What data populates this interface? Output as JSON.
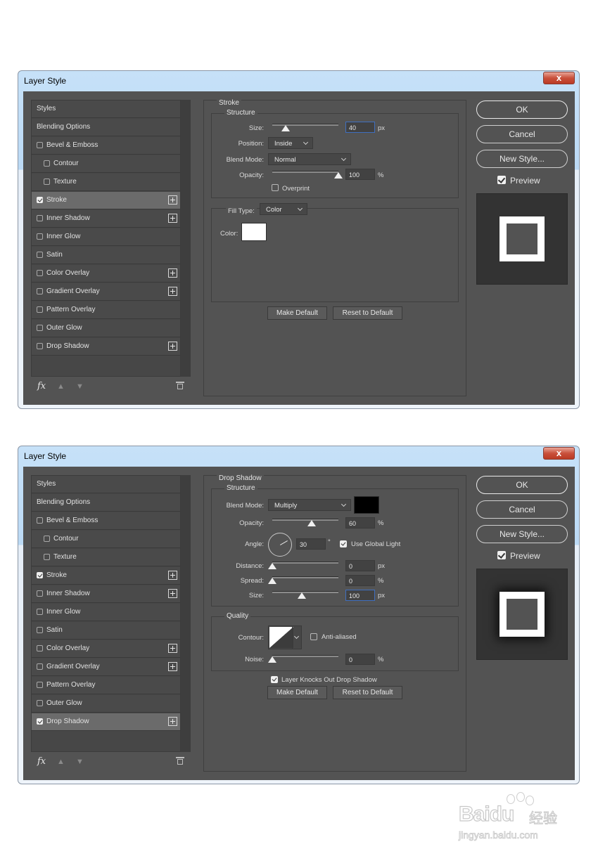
{
  "dialog1": {
    "title": "Layer Style",
    "close_label": "x",
    "list": [
      {
        "label": "Styles",
        "checkbox": false,
        "checked": false,
        "plus": false,
        "indent": false,
        "selected": false
      },
      {
        "label": "Blending Options",
        "checkbox": false,
        "checked": false,
        "plus": false,
        "indent": false,
        "selected": false
      },
      {
        "label": "Bevel & Emboss",
        "checkbox": true,
        "checked": false,
        "plus": false,
        "indent": false,
        "selected": false
      },
      {
        "label": "Contour",
        "checkbox": true,
        "checked": false,
        "plus": false,
        "indent": true,
        "selected": false
      },
      {
        "label": "Texture",
        "checkbox": true,
        "checked": false,
        "plus": false,
        "indent": true,
        "selected": false
      },
      {
        "label": "Stroke",
        "checkbox": true,
        "checked": true,
        "plus": true,
        "indent": false,
        "selected": true
      },
      {
        "label": "Inner Shadow",
        "checkbox": true,
        "checked": false,
        "plus": true,
        "indent": false,
        "selected": false
      },
      {
        "label": "Inner Glow",
        "checkbox": true,
        "checked": false,
        "plus": false,
        "indent": false,
        "selected": false
      },
      {
        "label": "Satin",
        "checkbox": true,
        "checked": false,
        "plus": false,
        "indent": false,
        "selected": false
      },
      {
        "label": "Color Overlay",
        "checkbox": true,
        "checked": false,
        "plus": true,
        "indent": false,
        "selected": false
      },
      {
        "label": "Gradient Overlay",
        "checkbox": true,
        "checked": false,
        "plus": true,
        "indent": false,
        "selected": false
      },
      {
        "label": "Pattern Overlay",
        "checkbox": true,
        "checked": false,
        "plus": false,
        "indent": false,
        "selected": false
      },
      {
        "label": "Outer Glow",
        "checkbox": true,
        "checked": false,
        "plus": false,
        "indent": false,
        "selected": false
      },
      {
        "label": "Drop Shadow",
        "checkbox": true,
        "checked": false,
        "plus": true,
        "indent": false,
        "selected": false
      }
    ],
    "fx_label": "fx",
    "panel": {
      "title": "Stroke",
      "structure_title": "Structure",
      "size_label": "Size:",
      "size_value": "40",
      "size_unit": "px",
      "size_fraction": 0.2,
      "position_label": "Position:",
      "position_value": "Inside",
      "blend_label": "Blend Mode:",
      "blend_value": "Normal",
      "opacity_label": "Opacity:",
      "opacity_value": "100",
      "opacity_unit": "%",
      "opacity_fraction": 1.0,
      "overprint_label": "Overprint",
      "filltype_label": "Fill Type:",
      "filltype_value": "Color",
      "color_label": "Color:",
      "stroke_color": "#ffffff",
      "make_default": "Make Default",
      "reset_default": "Reset to Default"
    },
    "buttons": {
      "ok": "OK",
      "cancel": "Cancel",
      "new_style": "New Style...",
      "preview": "Preview"
    }
  },
  "dialog2": {
    "title": "Layer Style",
    "close_label": "x",
    "list": [
      {
        "label": "Styles",
        "checkbox": false,
        "checked": false,
        "plus": false,
        "indent": false,
        "selected": false
      },
      {
        "label": "Blending Options",
        "checkbox": false,
        "checked": false,
        "plus": false,
        "indent": false,
        "selected": false
      },
      {
        "label": "Bevel & Emboss",
        "checkbox": true,
        "checked": false,
        "plus": false,
        "indent": false,
        "selected": false
      },
      {
        "label": "Contour",
        "checkbox": true,
        "checked": false,
        "plus": false,
        "indent": true,
        "selected": false
      },
      {
        "label": "Texture",
        "checkbox": true,
        "checked": false,
        "plus": false,
        "indent": true,
        "selected": false
      },
      {
        "label": "Stroke",
        "checkbox": true,
        "checked": true,
        "plus": true,
        "indent": false,
        "selected": false
      },
      {
        "label": "Inner Shadow",
        "checkbox": true,
        "checked": false,
        "plus": true,
        "indent": false,
        "selected": false
      },
      {
        "label": "Inner Glow",
        "checkbox": true,
        "checked": false,
        "plus": false,
        "indent": false,
        "selected": false
      },
      {
        "label": "Satin",
        "checkbox": true,
        "checked": false,
        "plus": false,
        "indent": false,
        "selected": false
      },
      {
        "label": "Color Overlay",
        "checkbox": true,
        "checked": false,
        "plus": true,
        "indent": false,
        "selected": false
      },
      {
        "label": "Gradient Overlay",
        "checkbox": true,
        "checked": false,
        "plus": true,
        "indent": false,
        "selected": false
      },
      {
        "label": "Pattern Overlay",
        "checkbox": true,
        "checked": false,
        "plus": false,
        "indent": false,
        "selected": false
      },
      {
        "label": "Outer Glow",
        "checkbox": true,
        "checked": false,
        "plus": false,
        "indent": false,
        "selected": false
      },
      {
        "label": "Drop Shadow",
        "checkbox": true,
        "checked": true,
        "plus": true,
        "indent": false,
        "selected": true
      }
    ],
    "fx_label": "fx",
    "panel": {
      "title": "Drop Shadow",
      "structure_title": "Structure",
      "blend_label": "Blend Mode:",
      "blend_value": "Multiply",
      "shadow_color": "#000000",
      "opacity_label": "Opacity:",
      "opacity_value": "60",
      "opacity_unit": "%",
      "opacity_fraction": 0.6,
      "angle_label": "Angle:",
      "angle_value": "30",
      "angle_unit": "°",
      "global_light_label": "Use Global Light",
      "distance_label": "Distance:",
      "distance_value": "0",
      "distance_unit": "px",
      "distance_fraction": 0.0,
      "spread_label": "Spread:",
      "spread_value": "0",
      "spread_unit": "%",
      "spread_fraction": 0.0,
      "size_label": "Size:",
      "size_value": "100",
      "size_unit": "px",
      "size_fraction": 0.45,
      "quality_title": "Quality",
      "contour_label": "Contour:",
      "antialiased_label": "Anti-aliased",
      "noise_label": "Noise:",
      "noise_value": "0",
      "noise_unit": "%",
      "noise_fraction": 0.0,
      "knockout_label": "Layer Knocks Out Drop Shadow",
      "make_default": "Make Default",
      "reset_default": "Reset to Default"
    },
    "buttons": {
      "ok": "OK",
      "cancel": "Cancel",
      "new_style": "New Style...",
      "preview": "Preview"
    }
  },
  "watermark": {
    "logo": "Baidu",
    "cn": "经验",
    "url": "jingyan.baidu.com"
  }
}
